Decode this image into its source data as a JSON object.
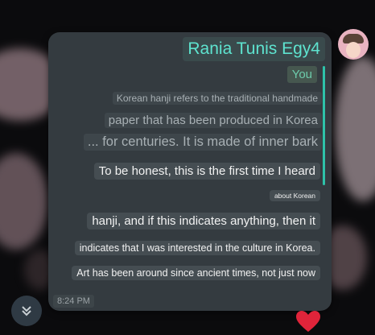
{
  "message": {
    "sender_name": "Rania Tunis Egy4",
    "reply": {
      "to": "You",
      "quoted_lines": [
        "Korean hanji refers to the traditional handmade",
        "paper that has been produced in Korea",
        "... for centuries. It is made of inner bark"
      ]
    },
    "lines": [
      "To be honest, this is the first time I heard",
      "about Korean",
      "hanji, and if this indicates anything, then it",
      "indicates that I was interested in the culture in Korea.",
      "Art has been around since ancient times, not just now"
    ],
    "time": "8:24 PM",
    "reaction": "heart-icon"
  },
  "colors": {
    "sender": "#5ee3cf",
    "reply_bar": "#2ec2a9",
    "bubble": "#343b40"
  }
}
